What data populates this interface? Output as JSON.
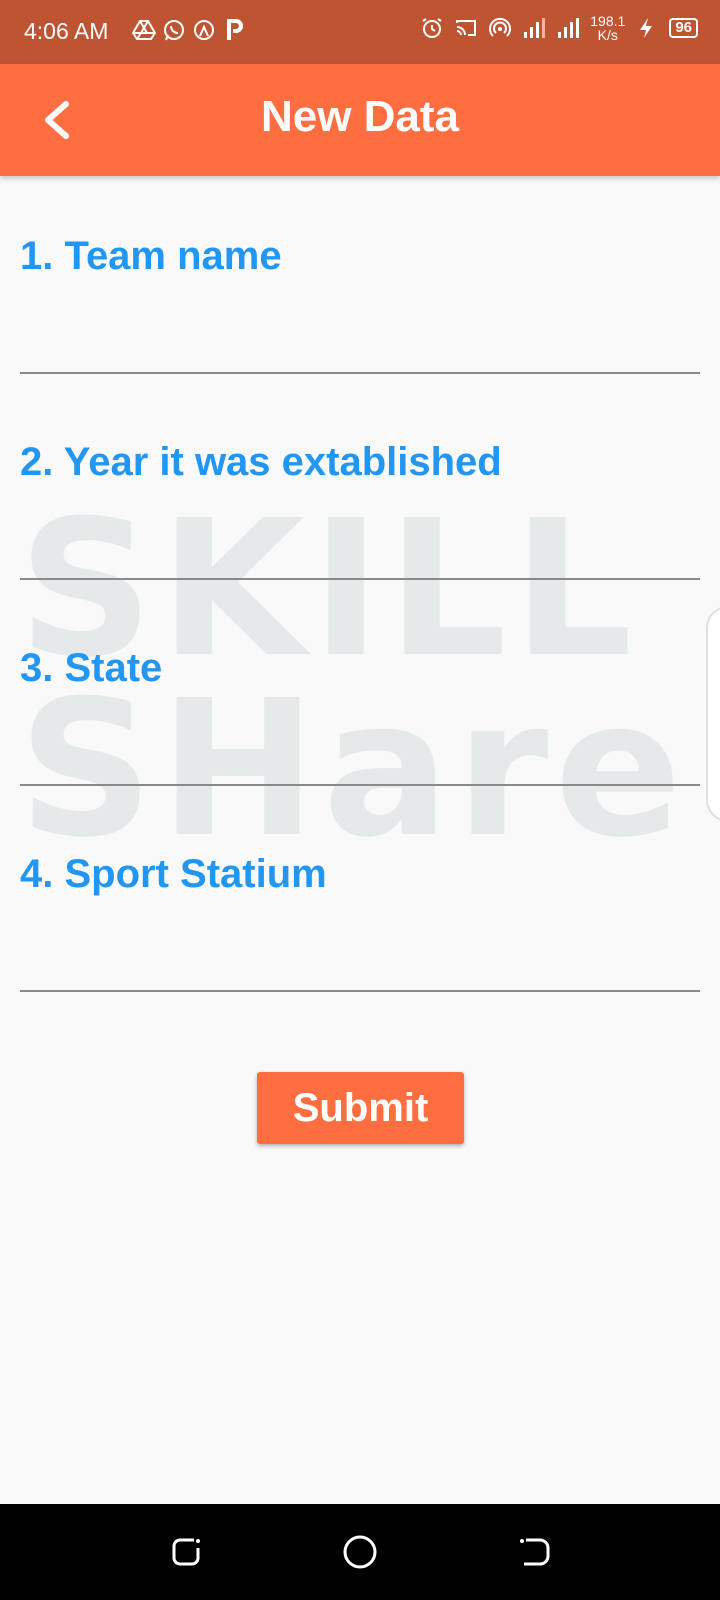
{
  "status_bar": {
    "time": "4:06 AM",
    "net_speed_value": "198.1",
    "net_speed_unit": "K/s",
    "battery": "96",
    "left_icons": [
      "drive-icon",
      "whatsapp-icon",
      "airdrop-icon",
      "p-app-icon"
    ],
    "right_icons": [
      "alarm-icon",
      "cast-icon",
      "hotspot-icon",
      "signal-icon",
      "signal-icon",
      "charging-icon"
    ]
  },
  "appbar": {
    "title": "New Data",
    "back_icon": "chevron-left-icon"
  },
  "form": {
    "fields": [
      {
        "label": "1. Team name",
        "value": ""
      },
      {
        "label": "2. Year it was extablished",
        "value": ""
      },
      {
        "label": "3. State",
        "value": ""
      },
      {
        "label": "4. Sport Statium",
        "value": ""
      }
    ],
    "submit_label": "Submit"
  },
  "watermark": {
    "line1": "SKILL",
    "line2": "SHare"
  },
  "nav_bar": {
    "buttons": [
      "recents-icon",
      "home-icon",
      "back-icon"
    ]
  },
  "colors": {
    "status_bar": "#bf5433",
    "appbar": "#ff6e40",
    "label": "#2196f3",
    "background": "#f9f9f9"
  }
}
